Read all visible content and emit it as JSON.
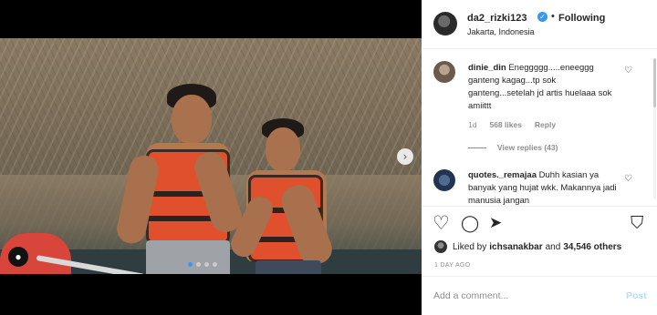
{
  "post": {
    "username": "da2_rizki123",
    "separator": "•",
    "follow_status": "Following",
    "location": "Jakarta, Indonesia",
    "verified_icon": "verified-badge-icon",
    "verified_glyph": "✓"
  },
  "media": {
    "carousel_next_glyph": "›",
    "user_tag_glyph": "●",
    "carousel_count": 4,
    "carousel_active": 1
  },
  "comments": [
    {
      "username": "dinie_din",
      "text": "Eneggggg.....eneeggg ganteng kagag...tp sok ganteng...setelah jd artis huelaaa sok amiittt",
      "time": "1d",
      "likes": "568 likes",
      "reply_label": "Reply",
      "view_replies": "View replies (43)"
    },
    {
      "username": "quotes._remajaa",
      "text": "Duhh kasian ya banyak yang hujat wkk. Makannya jadi manusia jangan"
    }
  ],
  "icons": {
    "heart_small": "♡",
    "like": "♡",
    "comment": "◯",
    "share": "➤",
    "save": "⛉"
  },
  "likes": {
    "prefix": "Liked by",
    "user": "ichsanakbar",
    "conjunction": "and",
    "count": "34,546 others"
  },
  "timestamp": "1 DAY AGO",
  "comment_box": {
    "placeholder": "Add a comment...",
    "post_label": "Post"
  },
  "colors": {
    "accent": "#3897f0",
    "post_disabled": "#b2dffc",
    "muted": "#8e8e8e"
  }
}
